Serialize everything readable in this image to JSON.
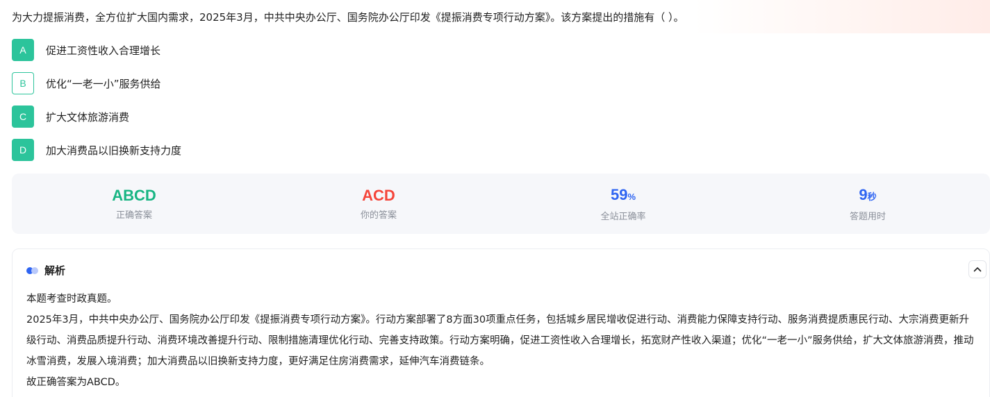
{
  "question": {
    "text": "为大力提振消费，全方位扩大国内需求，2025年3月，中共中央办公厅、国务院办公厅印发《提振消费专项行动方案》。该方案提出的措施有（ ）。"
  },
  "options": [
    {
      "letter": "A",
      "text": "促进工资性收入合理增长",
      "style": "filled"
    },
    {
      "letter": "B",
      "text": "优化“一老一小”服务供给",
      "style": "outline"
    },
    {
      "letter": "C",
      "text": "扩大文体旅游消费",
      "style": "filled"
    },
    {
      "letter": "D",
      "text": "加大消费品以旧换新支持力度",
      "style": "filled"
    }
  ],
  "stats": {
    "correct_answer": {
      "value": "ABCD",
      "label": "正确答案"
    },
    "your_answer": {
      "value": "ACD",
      "label": "你的答案"
    },
    "accuracy": {
      "value": "59",
      "unit": "%",
      "label": "全站正确率"
    },
    "time": {
      "value": "9",
      "unit": "秒",
      "label": "答题用时"
    }
  },
  "analysis": {
    "title": "解析",
    "paragraphs": [
      "本题考查时政真题。",
      "2025年3月，中共中央办公厅、国务院办公厅印发《提振消费专项行动方案》。行动方案部署了8方面30项重点任务，包括城乡居民增收促进行动、消费能力保障支持行动、服务消费提质惠民行动、大宗消费更新升级行动、消费品质提升行动、消费环境改善提升行动、限制措施清理优化行动、完善支持政策。行动方案明确，促进工资性收入合理增长，拓宽财产性收入渠道；优化“一老一小”服务供给，扩大文体旅游消费，推动冰雪消费，发展入境消费；加大消费品以旧换新支持力度，更好满足住房消费需求，延伸汽车消费链条。",
      "故正确答案为ABCD。"
    ]
  },
  "colors": {
    "accent_green": "#2cc49b",
    "correct_green": "#18b583",
    "wrong_red": "#f5453a",
    "stat_blue": "#2e64f2"
  },
  "icons": {
    "analysis_icon": "dots-icon",
    "collapse_icon": "chevron-up-icon"
  }
}
